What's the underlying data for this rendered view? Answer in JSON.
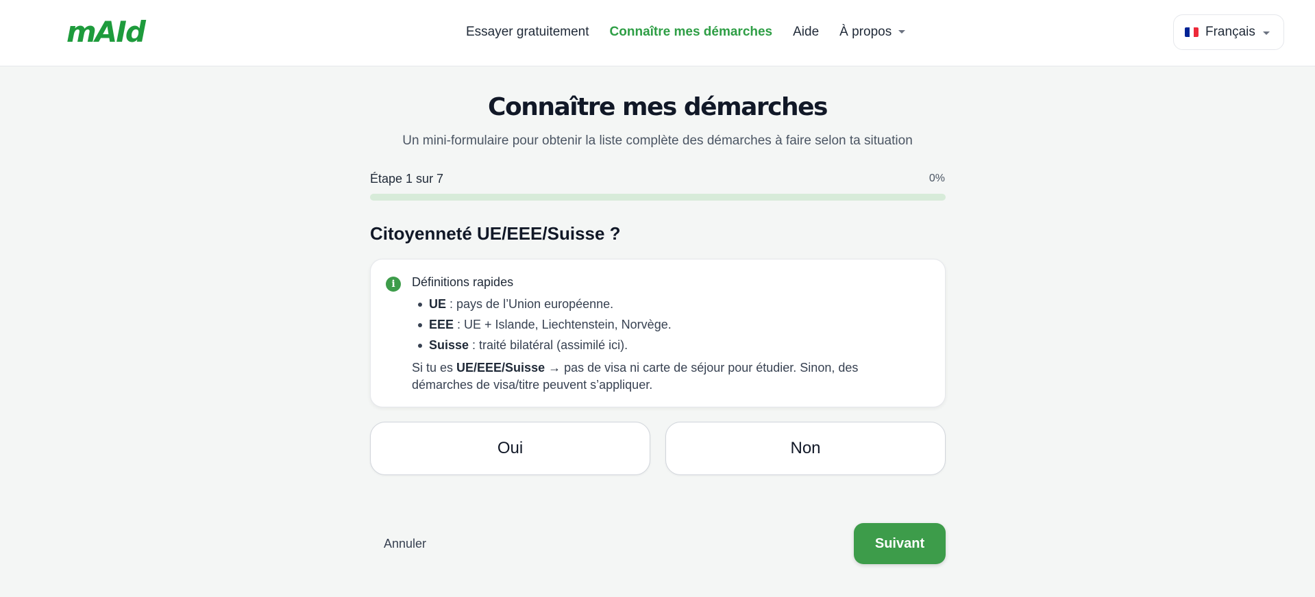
{
  "header": {
    "logo": "mAId",
    "nav": {
      "try_free": "Essayer gratuitement",
      "know_steps": "Connaître mes démarches",
      "help": "Aide",
      "about": "À propos"
    },
    "language": {
      "label": "Français",
      "flag_colors": [
        "#002395",
        "#ffffff",
        "#ed2939"
      ]
    }
  },
  "main": {
    "title": "Connaître mes démarches",
    "subtitle": "Un mini-formulaire pour obtenir la liste complète des démarches à faire selon ta situation",
    "step_label": "Étape 1 sur 7",
    "progress_percent_text": "0%",
    "progress_value": 0,
    "question": "Citoyenneté UE/EEE/Suisse ?",
    "info": {
      "icon": "info-icon",
      "title": "Définitions rapides",
      "items": [
        {
          "term": "UE",
          "definition": " : pays de l’Union européenne."
        },
        {
          "term": "EEE",
          "definition": " : UE + Islande, Liechtenstein, Norvège."
        },
        {
          "term": "Suisse",
          "definition": " : traité bilatéral (assimilé ici)."
        }
      ],
      "note_prefix": "Si tu es ",
      "note_bold": "UE/EEE/Suisse →",
      "note_suffix": " pas de visa ni carte de séjour pour étudier. Sinon, des démarches de visa/titre peuvent s’appliquer."
    },
    "choices": {
      "yes": "Oui",
      "no": "Non"
    },
    "actions": {
      "cancel": "Annuler",
      "next": "Suivant"
    }
  },
  "colors": {
    "accent": "#3d9c4a",
    "logo": "#1e9b3c",
    "progress_track": "#d7ebd9"
  }
}
